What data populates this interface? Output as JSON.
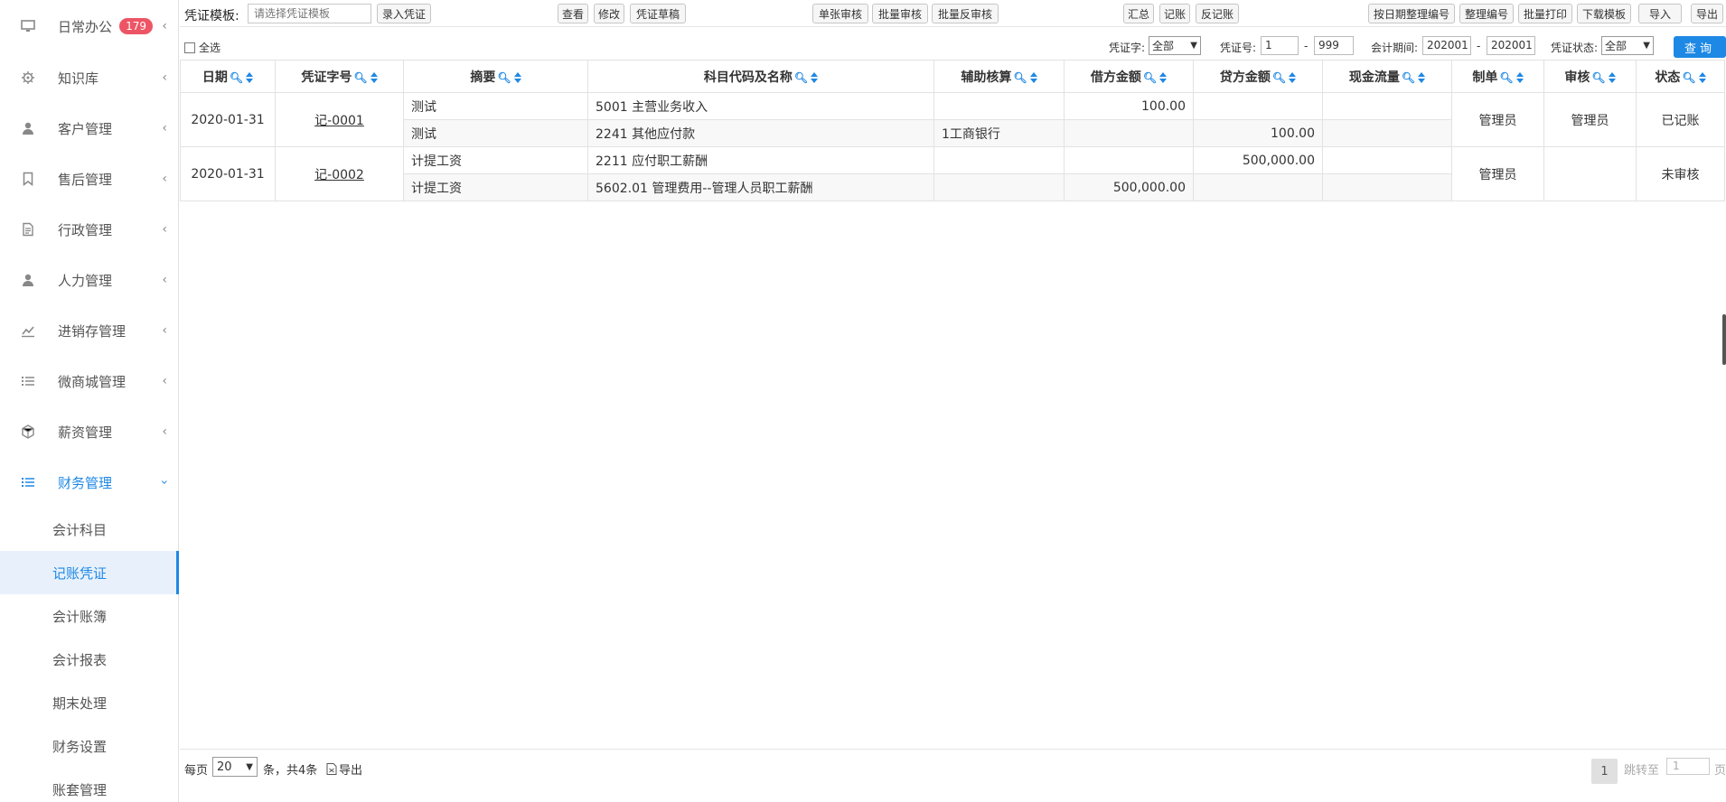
{
  "sidebar": {
    "items": [
      {
        "label": "日常办公",
        "icon": "desktop-icon",
        "badge": "179"
      },
      {
        "label": "知识库",
        "icon": "gear-icon"
      },
      {
        "label": "客户管理",
        "icon": "user-icon"
      },
      {
        "label": "售后管理",
        "icon": "bookmark-icon"
      },
      {
        "label": "行政管理",
        "icon": "document-icon"
      },
      {
        "label": "人力管理",
        "icon": "user-icon"
      },
      {
        "label": "进销存管理",
        "icon": "chart-icon"
      },
      {
        "label": "微商城管理",
        "icon": "list-icon"
      },
      {
        "label": "薪资管理",
        "icon": "cube-icon"
      },
      {
        "label": "财务管理",
        "icon": "list-icon"
      }
    ],
    "sub_items": [
      {
        "label": "会计科目"
      },
      {
        "label": "记账凭证"
      },
      {
        "label": "会计账簿"
      },
      {
        "label": "会计报表"
      },
      {
        "label": "期末处理"
      },
      {
        "label": "财务设置"
      },
      {
        "label": "账套管理"
      }
    ]
  },
  "toolbar": {
    "template_label": "凭证模板:",
    "template_placeholder": "请选择凭证模板",
    "btn_enter": "录入凭证",
    "btn_view": "查看",
    "btn_edit": "修改",
    "btn_draft": "凭证草稿",
    "btn_single_audit": "单张审核",
    "btn_batch_audit": "批量审核",
    "btn_batch_unaudit": "批量反审核",
    "btn_summary": "汇总",
    "btn_post": "记账",
    "btn_unpost": "反记账",
    "btn_renumber_date": "按日期整理编号",
    "btn_renumber": "整理编号",
    "btn_batch_print": "批量打印",
    "btn_download_tpl": "下载模板",
    "btn_import": "导入",
    "btn_export": "导出"
  },
  "filters": {
    "select_all": "全选",
    "voucher_word_label": "凭证字:",
    "voucher_word_value": "全部",
    "voucher_no_label": "凭证号:",
    "voucher_no_from": "1",
    "voucher_no_to": "999",
    "dash": "-",
    "period_label": "会计期间:",
    "period_from": "202001",
    "period_to": "202001",
    "status_label": "凭证状态:",
    "status_value": "全部",
    "query": "查询"
  },
  "table": {
    "headers": [
      "日期",
      "凭证字号",
      "摘要",
      "科目代码及名称",
      "辅助核算",
      "借方金额",
      "贷方金额",
      "现金流量",
      "制单",
      "审核",
      "状态"
    ],
    "vouchers": [
      {
        "date": "2020-01-31",
        "number": "记-0001",
        "maker": "管理员",
        "auditor": "管理员",
        "status": "已记账",
        "lines": [
          {
            "summary": "测试",
            "account": "5001 主营业务收入",
            "aux": "",
            "debit": "100.00",
            "credit": "",
            "cash": ""
          },
          {
            "summary": "测试",
            "account": "2241 其他应付款",
            "aux": "1工商银行",
            "debit": "",
            "credit": "100.00",
            "cash": ""
          }
        ]
      },
      {
        "date": "2020-01-31",
        "number": "记-0002",
        "maker": "管理员",
        "auditor": "",
        "status": "未审核",
        "lines": [
          {
            "summary": "计提工资",
            "account": "2211 应付职工薪酬",
            "aux": "",
            "debit": "",
            "credit": "500,000.00",
            "cash": ""
          },
          {
            "summary": "计提工资",
            "account": "5602.01 管理费用--管理人员职工薪酬",
            "aux": "",
            "debit": "500,000.00",
            "credit": "",
            "cash": ""
          }
        ]
      }
    ]
  },
  "footer": {
    "per_page_label": "每页",
    "per_page_value": "20",
    "count_text": "条，共4条",
    "export_label": "导出",
    "current_page": "1",
    "jump_label": "跳转至",
    "jump_value": "1",
    "jump_tail": "页"
  },
  "colors": {
    "accent": "#1e88e5",
    "badge": "#ed5565"
  }
}
